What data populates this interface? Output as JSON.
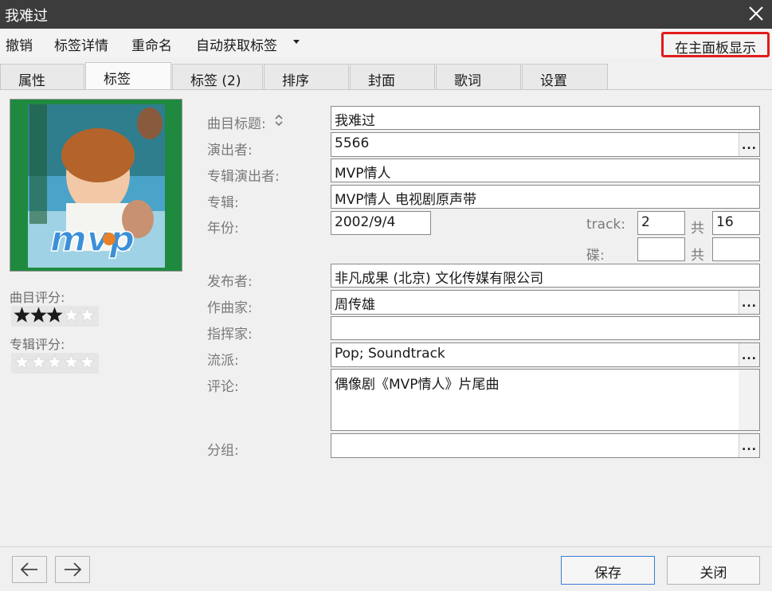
{
  "window": {
    "title": "我难过"
  },
  "menu": {
    "undo": "撤销",
    "tag_details": "标签详情",
    "rename": "重命名",
    "auto_fetch": "自动获取标签",
    "show_in_main": "在主面板显示"
  },
  "tabs": [
    "属性",
    "标签",
    "标签 (2)",
    "排序",
    "封面",
    "歌词",
    "设置"
  ],
  "active_tab": "标签",
  "ratings": {
    "track_label": "曲目评分:",
    "track_stars": 3,
    "album_label": "专辑评分:",
    "album_stars": 0,
    "max_stars": 5
  },
  "fields": {
    "title_label": "曲目标题:",
    "title": "我难过",
    "artist_label": "演出者:",
    "artist": "5566",
    "album_artist_label": "专辑演出者:",
    "album_artist": "MVP情人",
    "album_label": "专辑:",
    "album": "MVP情人 电视剧原声带",
    "year_label": "年份:",
    "year": "2002/9/4",
    "track_label": "track:",
    "track": "2",
    "track_total_label": "共",
    "track_total": "16",
    "disc_label": "碟:",
    "disc": "",
    "disc_total_label": "共",
    "disc_total": "",
    "publisher_label": "发布者:",
    "publisher": "非凡成果 (北京) 文化传媒有限公司",
    "composer_label": "作曲家:",
    "composer": "周传雄",
    "conductor_label": "指挥家:",
    "conductor": "",
    "genre_label": "流派:",
    "genre": "Pop; Soundtrack",
    "comment_label": "评论:",
    "comment": "偶像剧《MVP情人》片尾曲",
    "grouping_label": "分组:",
    "grouping": ""
  },
  "buttons": {
    "save": "保存",
    "close": "关闭",
    "ellipsis": "..."
  },
  "colors": {
    "highlight_border": "#e21b1b",
    "titlebar": "#3c3c3c",
    "primary_border": "#3b7bd6",
    "star_on": "#1a1a1a",
    "star_off": "#ffffff"
  }
}
